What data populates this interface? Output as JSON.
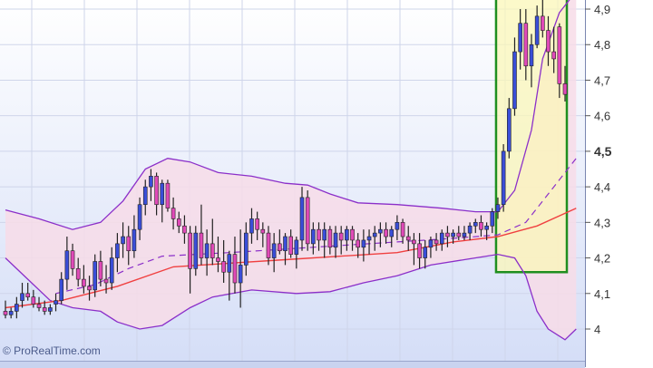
{
  "watermark": "© ProRealTime.com",
  "colors": {
    "background_top": "#ffffff",
    "background_bottom": "#d5def7",
    "band_fill": "#f7dce8",
    "band_line": "#8b2fc9",
    "ma_line": "#f04040",
    "bullish_body": "#3a4ed8",
    "bearish_body": "#e04ab8",
    "wick": "#222222",
    "highlight_fill": "#fbf7b8",
    "highlight_border": "#1f8f1f",
    "grid": "#cfd5ea"
  },
  "chart_data": {
    "type": "candlestick",
    "ylim": [
      3.97,
      4.93
    ],
    "yticks": [
      "4",
      "4,1",
      "4,2",
      "4,3",
      "4,4",
      "4,5",
      "4,6",
      "4,7",
      "4,8",
      "4,9"
    ],
    "ytick_values": [
      4.0,
      4.1,
      4.2,
      4.3,
      4.4,
      4.5,
      4.6,
      4.7,
      4.8,
      4.9
    ],
    "highlighted_tick": "4,5",
    "highlight_box": {
      "from_index": 88,
      "to_index": 100,
      "y_low": 4.16,
      "y_high": 4.93
    },
    "candles": [
      [
        4.05,
        4.08,
        4.03,
        4.04
      ],
      [
        4.04,
        4.06,
        4.03,
        4.05
      ],
      [
        4.05,
        4.09,
        4.03,
        4.07
      ],
      [
        4.08,
        4.13,
        4.06,
        4.1
      ],
      [
        4.1,
        4.13,
        4.08,
        4.09
      ],
      [
        4.09,
        4.11,
        4.06,
        4.07
      ],
      [
        4.07,
        4.09,
        4.05,
        4.06
      ],
      [
        4.06,
        4.08,
        4.04,
        4.05
      ],
      [
        4.05,
        4.07,
        4.04,
        4.06
      ],
      [
        4.07,
        4.1,
        4.05,
        4.08
      ],
      [
        4.08,
        4.16,
        4.07,
        4.14
      ],
      [
        4.14,
        4.26,
        4.11,
        4.22
      ],
      [
        4.22,
        4.24,
        4.15,
        4.17
      ],
      [
        4.17,
        4.2,
        4.12,
        4.14
      ],
      [
        4.14,
        4.18,
        4.1,
        4.12
      ],
      [
        4.12,
        4.15,
        4.08,
        4.11
      ],
      [
        4.11,
        4.21,
        4.09,
        4.19
      ],
      [
        4.19,
        4.22,
        4.12,
        4.14
      ],
      [
        4.14,
        4.18,
        4.1,
        4.13
      ],
      [
        4.13,
        4.23,
        4.11,
        4.2
      ],
      [
        4.2,
        4.27,
        4.16,
        4.24
      ],
      [
        4.24,
        4.3,
        4.2,
        4.26
      ],
      [
        4.26,
        4.29,
        4.18,
        4.22
      ],
      [
        4.22,
        4.32,
        4.2,
        4.28
      ],
      [
        4.28,
        4.37,
        4.25,
        4.35
      ],
      [
        4.35,
        4.42,
        4.32,
        4.4
      ],
      [
        4.4,
        4.45,
        4.36,
        4.43
      ],
      [
        4.43,
        4.44,
        4.32,
        4.35
      ],
      [
        4.35,
        4.42,
        4.3,
        4.41
      ],
      [
        4.41,
        4.42,
        4.33,
        4.34
      ],
      [
        4.34,
        4.37,
        4.28,
        4.31
      ],
      [
        4.31,
        4.33,
        4.27,
        4.29
      ],
      [
        4.29,
        4.32,
        4.24,
        4.27
      ],
      [
        4.27,
        4.29,
        4.1,
        4.17
      ],
      [
        4.17,
        4.29,
        4.15,
        4.27
      ],
      [
        4.27,
        4.35,
        4.18,
        4.2
      ],
      [
        4.2,
        4.28,
        4.15,
        4.24
      ],
      [
        4.24,
        4.31,
        4.18,
        4.2
      ],
      [
        4.2,
        4.26,
        4.16,
        4.19
      ],
      [
        4.19,
        4.25,
        4.13,
        4.16
      ],
      [
        4.16,
        4.22,
        4.08,
        4.21
      ],
      [
        4.21,
        4.26,
        4.1,
        4.13
      ],
      [
        4.13,
        4.28,
        4.06,
        4.18
      ],
      [
        4.18,
        4.3,
        4.15,
        4.27
      ],
      [
        4.27,
        4.34,
        4.24,
        4.31
      ],
      [
        4.31,
        4.33,
        4.25,
        4.28
      ],
      [
        4.28,
        4.3,
        4.23,
        4.27
      ],
      [
        4.27,
        4.29,
        4.18,
        4.2
      ],
      [
        4.2,
        4.27,
        4.16,
        4.24
      ],
      [
        4.24,
        4.28,
        4.21,
        4.22
      ],
      [
        4.22,
        4.27,
        4.18,
        4.26
      ],
      [
        4.26,
        4.28,
        4.2,
        4.21
      ],
      [
        4.21,
        4.26,
        4.17,
        4.25
      ],
      [
        4.25,
        4.4,
        4.22,
        4.37
      ],
      [
        4.37,
        4.39,
        4.22,
        4.24
      ],
      [
        4.24,
        4.3,
        4.21,
        4.28
      ],
      [
        4.28,
        4.3,
        4.22,
        4.25
      ],
      [
        4.25,
        4.3,
        4.2,
        4.28
      ],
      [
        4.28,
        4.29,
        4.21,
        4.23
      ],
      [
        4.23,
        4.29,
        4.2,
        4.27
      ],
      [
        4.27,
        4.29,
        4.21,
        4.25
      ],
      [
        4.25,
        4.29,
        4.22,
        4.28
      ],
      [
        4.28,
        4.29,
        4.22,
        4.25
      ],
      [
        4.25,
        4.27,
        4.2,
        4.23
      ],
      [
        4.23,
        4.28,
        4.19,
        4.25
      ],
      [
        4.25,
        4.28,
        4.21,
        4.26
      ],
      [
        4.26,
        4.29,
        4.22,
        4.27
      ],
      [
        4.27,
        4.3,
        4.23,
        4.28
      ],
      [
        4.28,
        4.3,
        4.24,
        4.26
      ],
      [
        4.26,
        4.29,
        4.23,
        4.28
      ],
      [
        4.28,
        4.32,
        4.25,
        4.3
      ],
      [
        4.3,
        4.31,
        4.24,
        4.26
      ],
      [
        4.26,
        4.29,
        4.22,
        4.25
      ],
      [
        4.25,
        4.27,
        4.18,
        4.24
      ],
      [
        4.24,
        4.27,
        4.17,
        4.2
      ],
      [
        4.2,
        4.25,
        4.17,
        4.23
      ],
      [
        4.23,
        4.26,
        4.2,
        4.25
      ],
      [
        4.25,
        4.27,
        4.22,
        4.24
      ],
      [
        4.24,
        4.28,
        4.22,
        4.27
      ],
      [
        4.27,
        4.29,
        4.23,
        4.26
      ],
      [
        4.26,
        4.28,
        4.24,
        4.27
      ],
      [
        4.27,
        4.29,
        4.25,
        4.26
      ],
      [
        4.26,
        4.29,
        4.25,
        4.27
      ],
      [
        4.27,
        4.3,
        4.25,
        4.29
      ],
      [
        4.29,
        4.31,
        4.27,
        4.3
      ],
      [
        4.3,
        4.32,
        4.26,
        4.28
      ],
      [
        4.28,
        4.3,
        4.25,
        4.29
      ],
      [
        4.29,
        4.34,
        4.27,
        4.33
      ],
      [
        4.33,
        4.37,
        4.31,
        4.35
      ],
      [
        4.35,
        4.52,
        4.33,
        4.5
      ],
      [
        4.5,
        4.65,
        4.48,
        4.62
      ],
      [
        4.62,
        4.82,
        4.6,
        4.78
      ],
      [
        4.78,
        4.9,
        4.73,
        4.86
      ],
      [
        4.86,
        4.9,
        4.7,
        4.74
      ],
      [
        4.74,
        4.83,
        4.68,
        4.8
      ],
      [
        4.8,
        4.91,
        4.79,
        4.88
      ],
      [
        4.88,
        4.93,
        4.82,
        4.84
      ],
      [
        4.84,
        4.88,
        4.74,
        4.78
      ],
      [
        4.78,
        4.85,
        4.72,
        4.76
      ],
      [
        4.85,
        4.86,
        4.65,
        4.69
      ],
      [
        4.69,
        4.74,
        4.64,
        4.66
      ]
    ],
    "moving_average": [
      [
        0,
        4.06
      ],
      [
        10,
        4.08
      ],
      [
        20,
        4.12
      ],
      [
        30,
        4.175
      ],
      [
        40,
        4.185
      ],
      [
        50,
        4.195
      ],
      [
        60,
        4.205
      ],
      [
        70,
        4.215
      ],
      [
        80,
        4.245
      ],
      [
        88,
        4.26
      ],
      [
        95,
        4.29
      ],
      [
        102,
        4.34
      ]
    ],
    "moving_average_short": [
      [
        9,
        4.1
      ],
      [
        16,
        4.125
      ],
      [
        22,
        4.17
      ],
      [
        28,
        4.205
      ],
      [
        40,
        4.215
      ],
      [
        50,
        4.225
      ],
      [
        60,
        4.235
      ],
      [
        70,
        4.245
      ],
      [
        80,
        4.255
      ],
      [
        88,
        4.265
      ],
      [
        93,
        4.3
      ],
      [
        97,
        4.38
      ],
      [
        102,
        4.48
      ]
    ],
    "bollinger_upper": [
      [
        0,
        4.335
      ],
      [
        6,
        4.31
      ],
      [
        12,
        4.28
      ],
      [
        17,
        4.3
      ],
      [
        21,
        4.36
      ],
      [
        25,
        4.45
      ],
      [
        29,
        4.48
      ],
      [
        33,
        4.47
      ],
      [
        38,
        4.44
      ],
      [
        44,
        4.43
      ],
      [
        50,
        4.41
      ],
      [
        54,
        4.405
      ],
      [
        58,
        4.38
      ],
      [
        63,
        4.355
      ],
      [
        70,
        4.35
      ],
      [
        78,
        4.34
      ],
      [
        84,
        4.33
      ],
      [
        88,
        4.33
      ],
      [
        91,
        4.39
      ],
      [
        94,
        4.56
      ],
      [
        96,
        4.76
      ],
      [
        99,
        4.89
      ],
      [
        102,
        4.95
      ]
    ],
    "bollinger_lower": [
      [
        0,
        4.2
      ],
      [
        4,
        4.14
      ],
      [
        8,
        4.08
      ],
      [
        12,
        4.06
      ],
      [
        17,
        4.05
      ],
      [
        20,
        4.02
      ],
      [
        24,
        4.0
      ],
      [
        28,
        4.01
      ],
      [
        33,
        4.06
      ],
      [
        37,
        4.09
      ],
      [
        44,
        4.11
      ],
      [
        52,
        4.1
      ],
      [
        58,
        4.105
      ],
      [
        64,
        4.13
      ],
      [
        70,
        4.15
      ],
      [
        76,
        4.18
      ],
      [
        82,
        4.195
      ],
      [
        88,
        4.21
      ],
      [
        91,
        4.2
      ],
      [
        93,
        4.15
      ],
      [
        95,
        4.05
      ],
      [
        97,
        4.0
      ],
      [
        100,
        3.97
      ],
      [
        102,
        4.0
      ]
    ]
  }
}
